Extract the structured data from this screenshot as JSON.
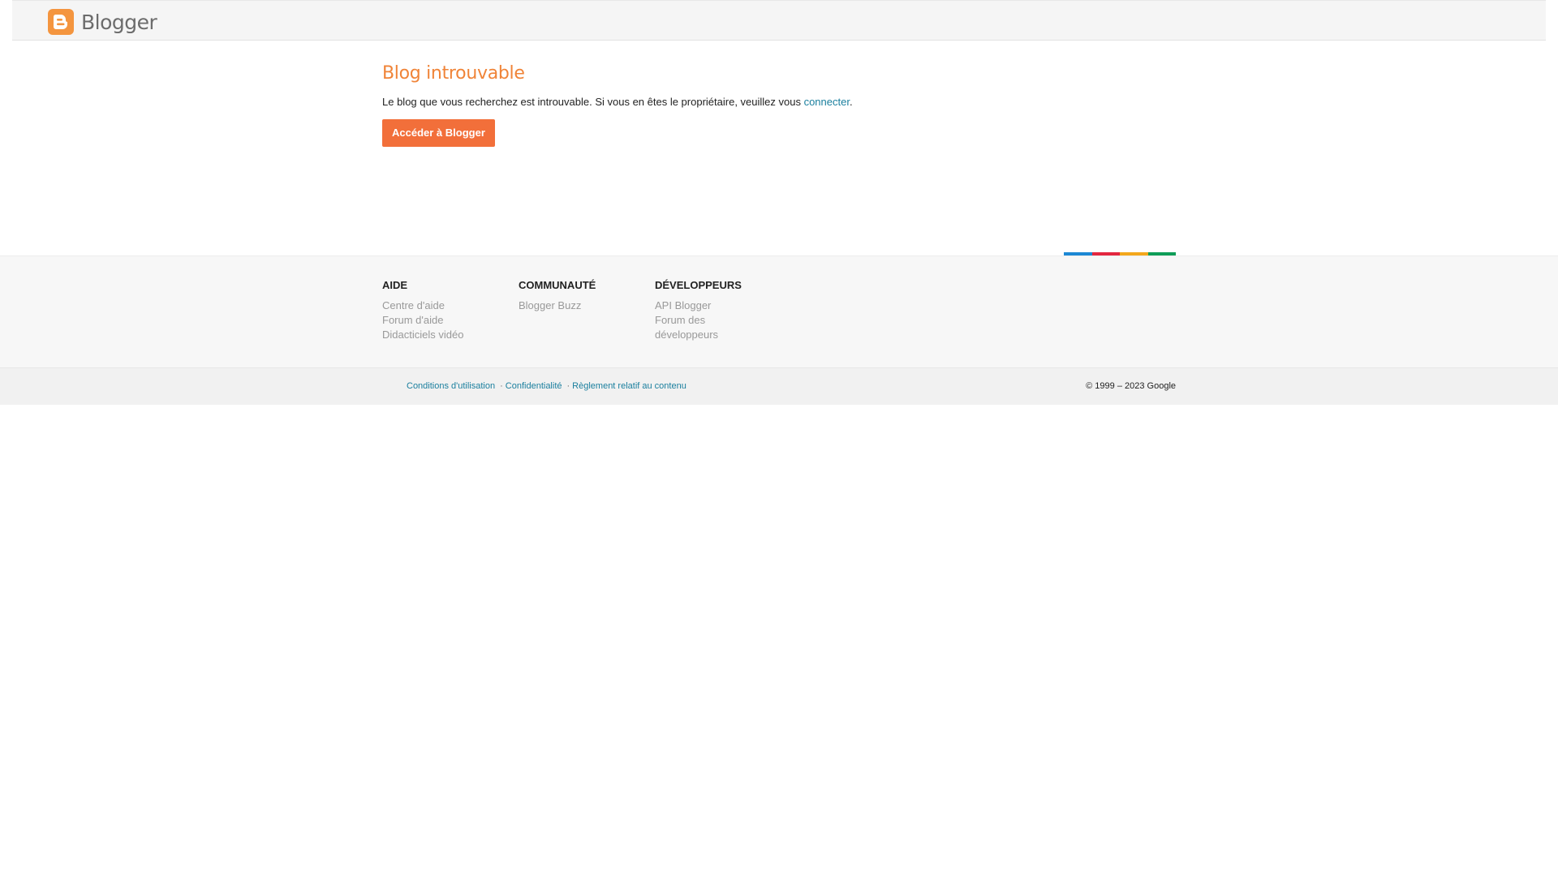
{
  "header": {
    "logo_text": "Blogger",
    "logo_letter": "B"
  },
  "main": {
    "title": "Blog introuvable",
    "message_before": "Le blog que vous recherchez est introuvable. Si vous en êtes le propriétaire, veuillez vous ",
    "message_link": "connecter",
    "message_after": ".",
    "cta_label": "Accéder à Blogger"
  },
  "colors": {
    "accent": "#f26f3a",
    "title": "#f08438",
    "link": "#1a7f9e",
    "bar": [
      "#1c88d4",
      "#e3263f",
      "#f3a71c",
      "#0f9d58"
    ]
  },
  "footer": {
    "columns": [
      {
        "heading": "AIDE",
        "links": [
          "Centre d'aide",
          "Forum d'aide",
          "Didacticiels vidéo"
        ]
      },
      {
        "heading": "COMMUNAUTÉ",
        "links": [
          "Blogger Buzz"
        ]
      },
      {
        "heading": "DÉVELOPPEURS",
        "links": [
          "API Blogger",
          "Forum des développeurs"
        ]
      }
    ],
    "legal_links": [
      "Conditions d'utilisation",
      "Confidentialité",
      "Règlement relatif au contenu"
    ],
    "separator": "·",
    "copyright": "© 1999 – 2023 Google"
  }
}
